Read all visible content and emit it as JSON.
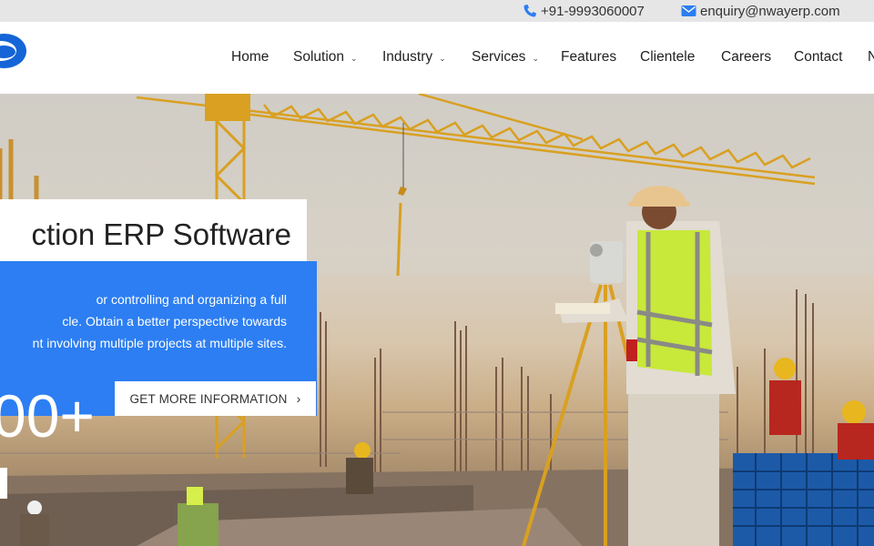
{
  "topbar": {
    "phone": "+91-9993060007",
    "email": "enquiry@nwayerp.com"
  },
  "nav": {
    "items": [
      {
        "label": "Home",
        "dropdown": false
      },
      {
        "label": "Solution",
        "dropdown": true
      },
      {
        "label": "Industry",
        "dropdown": true
      },
      {
        "label": "Services",
        "dropdown": true
      },
      {
        "label": "Features",
        "dropdown": false
      },
      {
        "label": "Clientele",
        "dropdown": false
      },
      {
        "label": "Careers",
        "dropdown": false
      },
      {
        "label": "Contact",
        "dropdown": false
      },
      {
        "label": "N",
        "dropdown": false
      }
    ],
    "chevron": "⌄"
  },
  "hero": {
    "title": "ction ERP Software",
    "description_lines": [
      "or controlling and organizing a full",
      "cle. Obtain a better perspective towards",
      "nt involving multiple projects at multiple sites."
    ],
    "counter": "00+",
    "button_label": "GET MORE INFORMATION",
    "button_arrow": "›"
  },
  "colors": {
    "accent_blue": "#2c7ef2",
    "crane_yellow": "#d9a021",
    "vest_green": "#c8e83a"
  }
}
